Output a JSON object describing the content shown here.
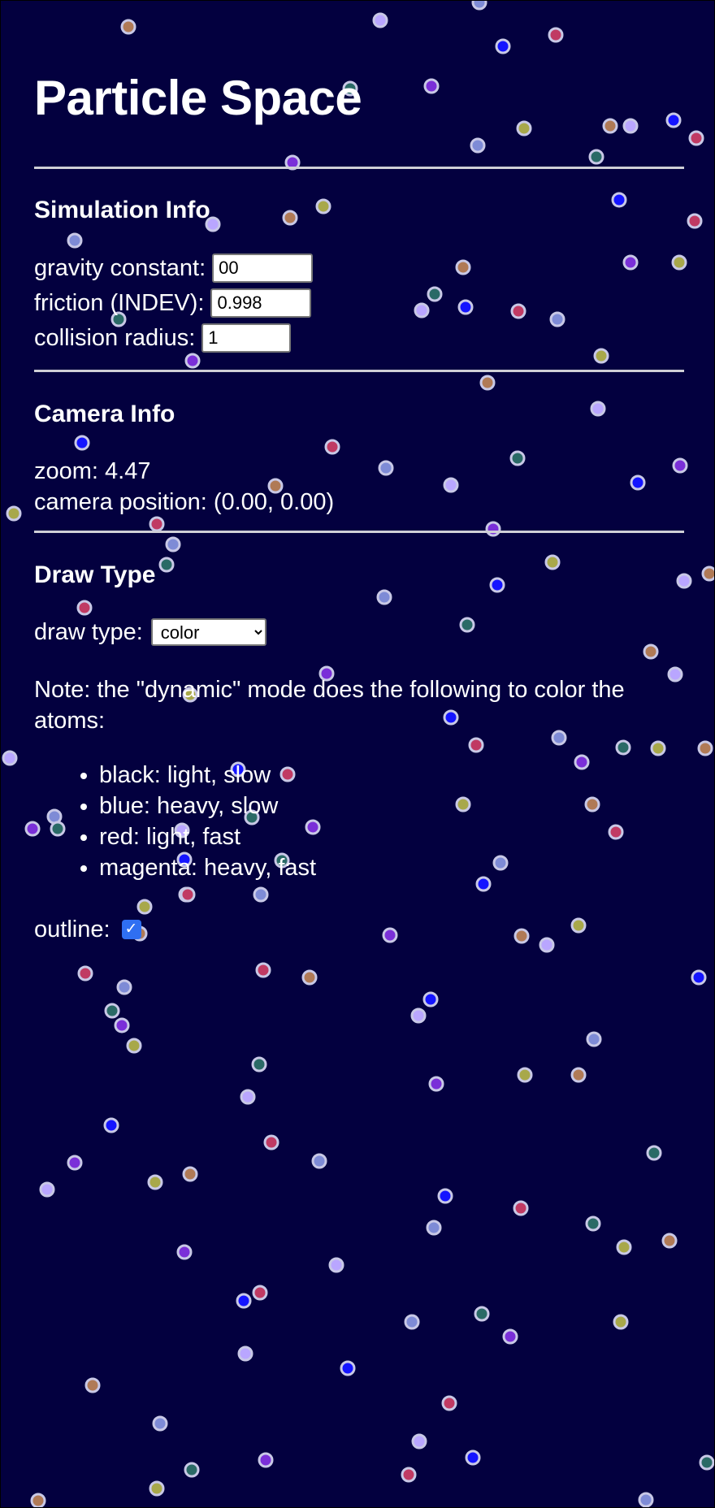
{
  "title": "Particle Space",
  "simulation": {
    "heading": "Simulation Info",
    "gravity_label": "gravity constant:",
    "gravity_value": "00",
    "friction_label": "friction (INDEV):",
    "friction_value": "0.998",
    "collision_label": "collision radius:",
    "collision_value": "1"
  },
  "camera": {
    "heading": "Camera Info",
    "zoom_label": "zoom: 4.47",
    "position_label": "camera position: (0.00, 0.00)"
  },
  "draw": {
    "heading": "Draw Type",
    "draw_type_label": "draw type:",
    "draw_type_selected": "color",
    "note": "Note: the \"dynamic\" mode does the following to color the atoms:",
    "legend": [
      "black: light, slow",
      "blue: heavy, slow",
      "red: light, fast",
      "magenta: heavy, fast"
    ],
    "outline_label": "outline:",
    "outline_checked": true
  },
  "colors": {
    "background": "#03003f",
    "particle_fills": [
      "#b9a6ff",
      "#7a2fd8",
      "#c03a63",
      "#b07a56",
      "#2a6a66",
      "#1414ff",
      "#a8a84a",
      "#7e8bd6"
    ],
    "particle_outline": "#c8c8e6"
  }
}
